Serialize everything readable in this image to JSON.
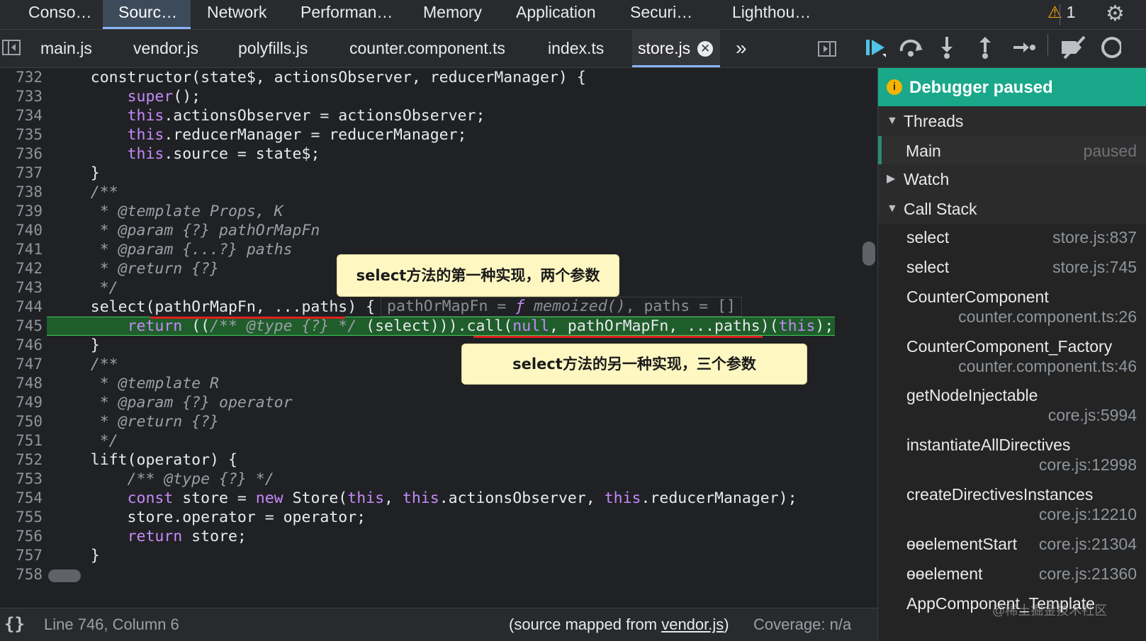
{
  "panel_tabs": [
    "Conso…",
    "Sourc…",
    "Network",
    "Performan…",
    "Memory",
    "Application",
    "Securi…",
    "Lighthou…"
  ],
  "warnings_count": "1",
  "file_tabs": [
    "main.js",
    "vendor.js",
    "polyfills.js",
    "counter.component.ts",
    "index.ts",
    "store.js"
  ],
  "more_tabs_glyph": "»",
  "code_lines": [
    {
      "n": "732",
      "t": "    constructor(state$, actionsObserver, reducerManager) {"
    },
    {
      "n": "733",
      "t": "        super();"
    },
    {
      "n": "734",
      "t": "        this.actionsObserver = actionsObserver;"
    },
    {
      "n": "735",
      "t": "        this.reducerManager = reducerManager;"
    },
    {
      "n": "736",
      "t": "        this.source = state$;"
    },
    {
      "n": "737",
      "t": "    }"
    },
    {
      "n": "738",
      "t": "    /**"
    },
    {
      "n": "739",
      "t": "     * @template Props, K"
    },
    {
      "n": "740",
      "t": "     * @param {?} pathOrMapFn"
    },
    {
      "n": "741",
      "t": "     * @param {...?} paths"
    },
    {
      "n": "742",
      "t": "     * @return {?}"
    },
    {
      "n": "743",
      "t": "     */"
    },
    {
      "n": "744",
      "t": "    select(pathOrMapFn, ...paths) {"
    },
    {
      "n": "745",
      "t": "        return ((/** @type {?} */ (select))).call(null, pathOrMapFn, ...paths)(this);"
    },
    {
      "n": "746",
      "t": "    }"
    },
    {
      "n": "747",
      "t": "    /**"
    },
    {
      "n": "748",
      "t": "     * @template R"
    },
    {
      "n": "749",
      "t": "     * @param {?} operator"
    },
    {
      "n": "750",
      "t": "     * @return {?}"
    },
    {
      "n": "751",
      "t": "     */"
    },
    {
      "n": "752",
      "t": "    lift(operator) {"
    },
    {
      "n": "753",
      "t": "        /** @type {?} */"
    },
    {
      "n": "754",
      "t": "        const store = new Store(this, this.actionsObserver, this.reducerManager);"
    },
    {
      "n": "755",
      "t": "        store.operator = operator;"
    },
    {
      "n": "756",
      "t": "        return store;"
    },
    {
      "n": "757",
      "t": "    }"
    },
    {
      "n": "758",
      "t": ""
    }
  ],
  "inline_values": {
    "pathOrMapFn_label": "pathOrMapFn = ",
    "f_glyph": "ƒ",
    "memoized": " memoized()",
    "paths": ", paths = []"
  },
  "callouts": {
    "first": "select方法的第一种实现，两个参数",
    "second": "select方法的另一种实现，三个参数"
  },
  "status": {
    "braces": "{}",
    "position": "Line 746, Column 6",
    "mapped_prefix": "(source mapped from ",
    "mapped_file": "vendor.js",
    "mapped_suffix": ")",
    "coverage": "Coverage: n/a"
  },
  "sidebar": {
    "paused_title": "Debugger paused",
    "threads_label": "Threads",
    "thread_name": "Main",
    "thread_status": "paused",
    "watch_label": "Watch",
    "callstack_label": "Call Stack",
    "frames": [
      {
        "fn": "select",
        "loc": "store.js:837"
      },
      {
        "fn": "select",
        "loc": "store.js:745"
      },
      {
        "fn": "CounterComponent",
        "loc": "counter.component.ts:26"
      },
      {
        "fn": "CounterComponent_Factory",
        "loc": "counter.component.ts:46"
      },
      {
        "fn": "getNodeInjectable",
        "loc": "core.js:5994"
      },
      {
        "fn": "instantiateAllDirectives",
        "loc": "core.js:12998"
      },
      {
        "fn": "createDirectivesInstances",
        "loc": "core.js:12210"
      },
      {
        "fn": "ɵɵelementStart",
        "loc": "core.js:21304"
      },
      {
        "fn": "ɵɵelement",
        "loc": "core.js:21360"
      },
      {
        "fn": "AppComponent_Template",
        "loc": ""
      }
    ]
  },
  "watermark": "@稀土掘金技术社区",
  "colors": {
    "paused_bg": "#1aa88a",
    "exec_line": "#1f5d2b",
    "callout_bg": "#fff7c2",
    "underline": "#e02020"
  }
}
